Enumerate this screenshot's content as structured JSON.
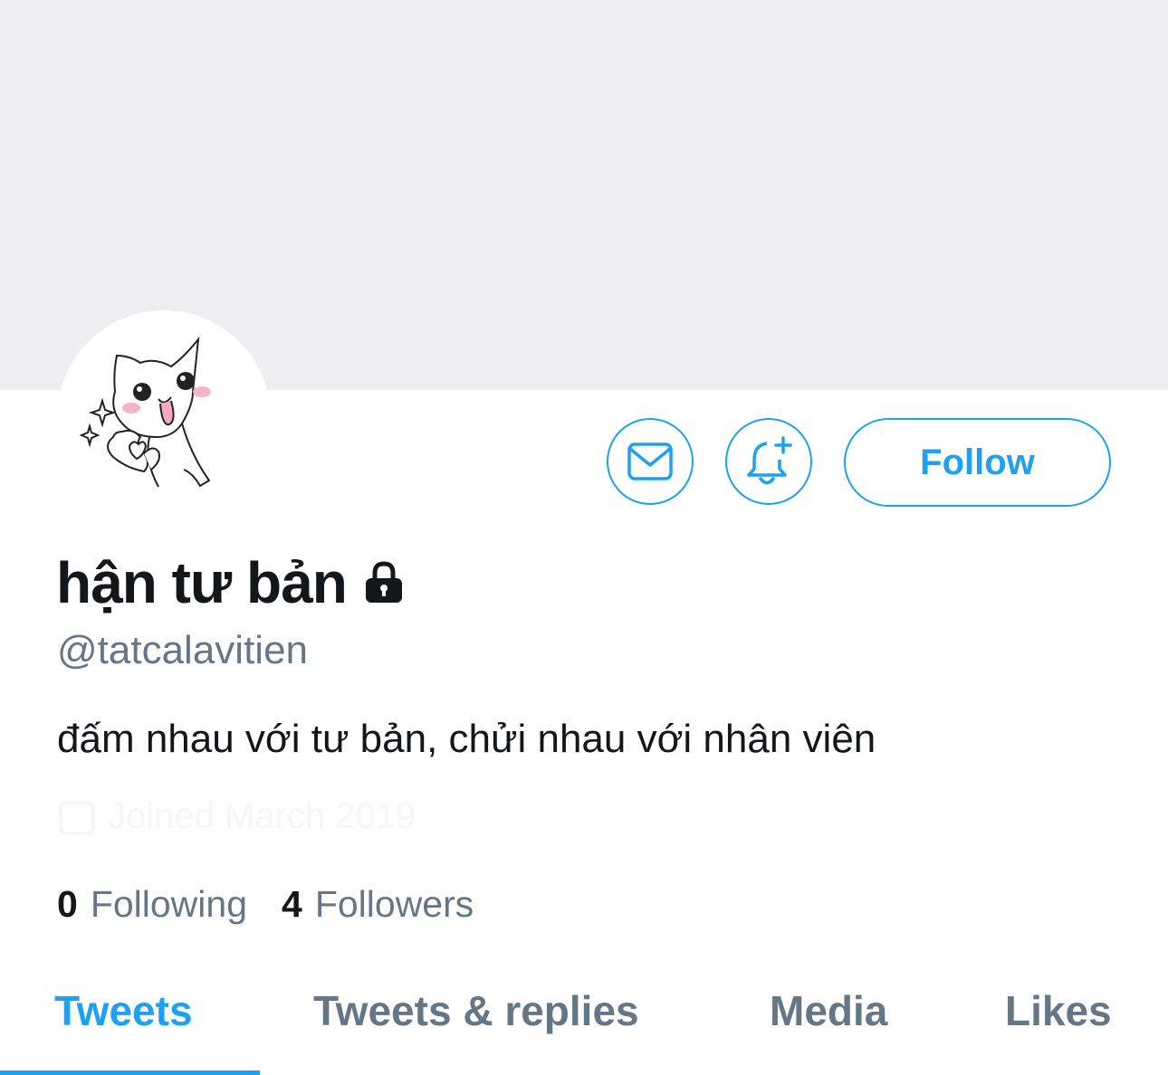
{
  "profile": {
    "display_name": "hận tư bản",
    "handle": "@tatcalavitien",
    "bio": "đấm nhau với tư bản, chửi nhau với nhân viên",
    "protected": true,
    "lock_icon": "lock-icon",
    "avatar_icon": "cat-heart-avatar",
    "faded_text": "Joined March 2019"
  },
  "actions": {
    "message_icon": "mail-icon",
    "notify_icon": "bell-plus-icon",
    "follow_label": "Follow"
  },
  "stats": {
    "following_count": "0",
    "following_label": "Following",
    "followers_count": "4",
    "followers_label": "Followers"
  },
  "tabs": [
    {
      "label": "Tweets",
      "active": true
    },
    {
      "label": "Tweets & replies",
      "active": false
    },
    {
      "label": "Media",
      "active": false
    },
    {
      "label": "Likes",
      "active": false
    }
  ],
  "colors": {
    "accent": "#1da1f2",
    "secondary_text": "#657786",
    "primary_text": "#14171a",
    "banner": "#eeeef0"
  }
}
